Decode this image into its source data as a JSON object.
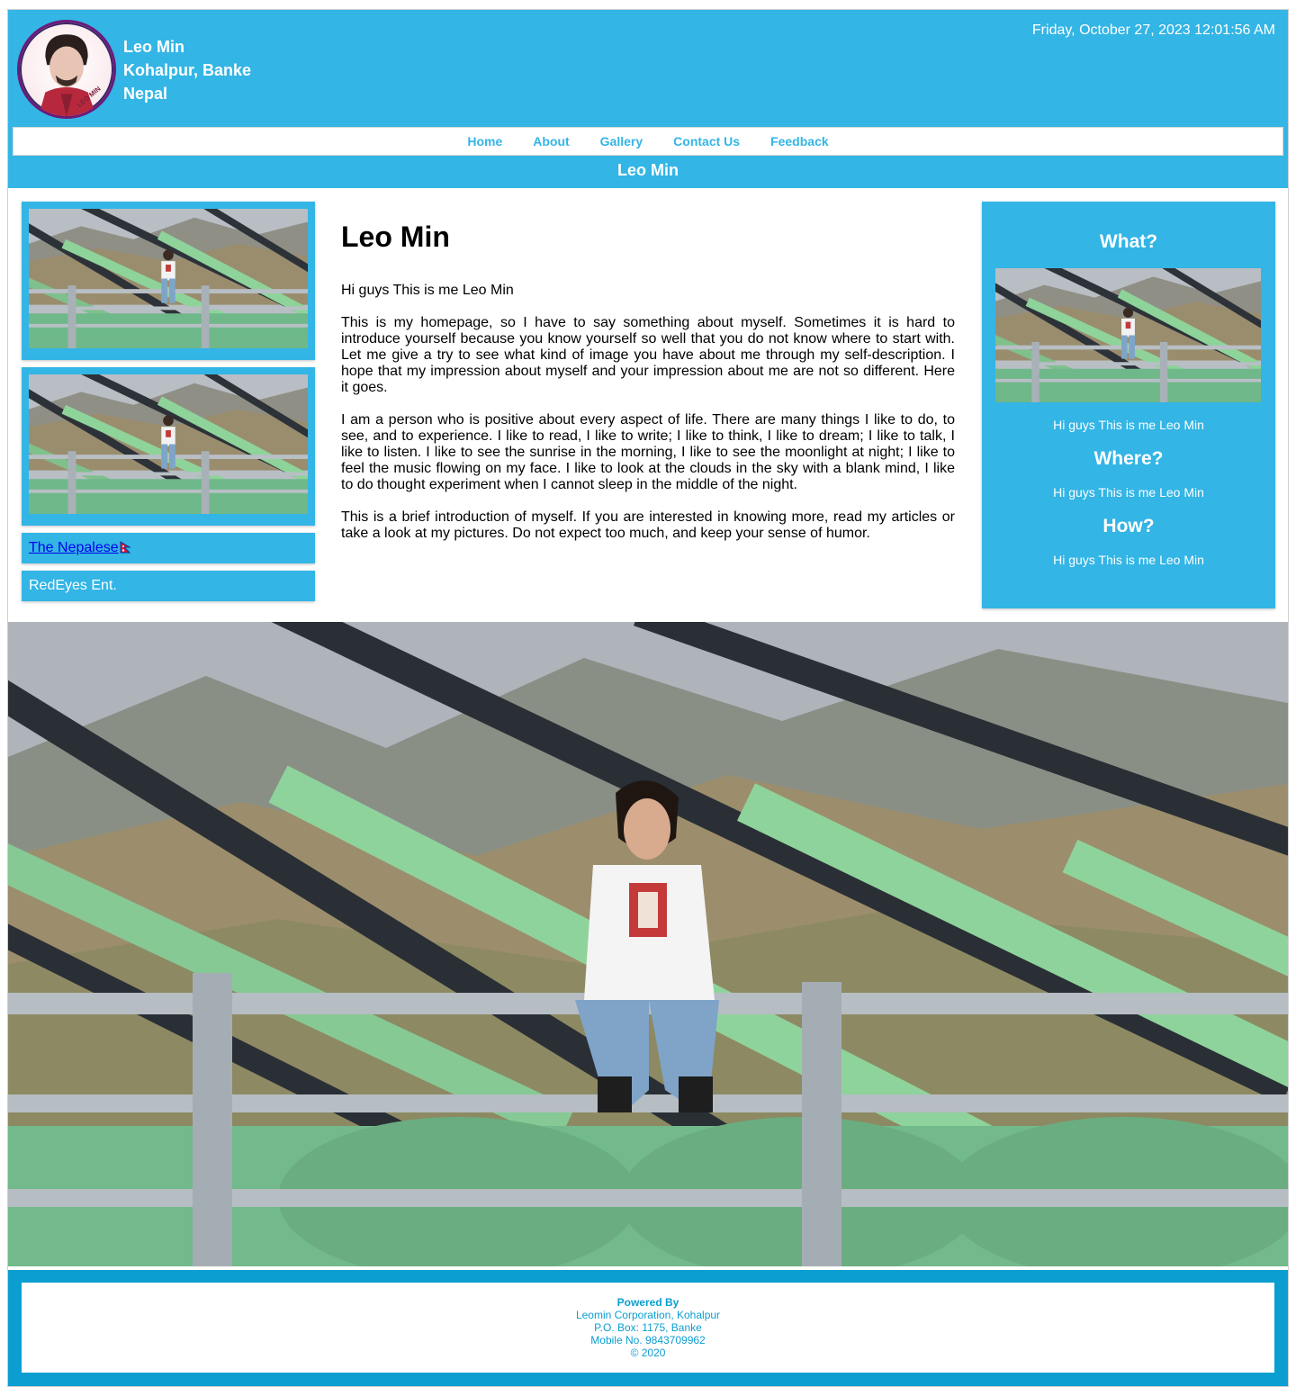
{
  "header": {
    "name": "Leo Min",
    "location": "Kohalpur, Banke",
    "country": "Nepal",
    "datetime": "Friday, October 27, 2023 12:01:56 AM",
    "avatar_text": "LEO MIN"
  },
  "nav": {
    "items": [
      "Home",
      "About",
      "Gallery",
      "Contact Us",
      "Feedback"
    ]
  },
  "banner": {
    "title": "Leo Min"
  },
  "sidebar_left": {
    "link_text": "The Nepalese",
    "plain_text": "RedEyes Ent."
  },
  "main": {
    "heading": "Leo Min",
    "paragraphs": [
      "Hi guys This is me Leo Min",
      "This is my homepage, so I have to say something about myself. Sometimes it is hard to introduce yourself because you know yourself so well that you do not know where to start with. Let me give a try to see what kind of image you have about me through my self-description. I hope that my impression about myself and your impression about me are not so different. Here it goes.",
      "I am a person who is positive about every aspect of life. There are many things I like to do, to see, and to experience. I like to read, I like to write; I like to think, I like to dream; I like to talk, I like to listen. I like to see the sunrise in the morning, I like to see the moonlight at night; I like to feel the music flowing on my face. I like to look at the clouds in the sky with a blank mind, I like to do thought experiment when I cannot sleep in the middle of the night.",
      "This is a brief introduction of myself. If you are interested in knowing more, read my articles or take a look at my pictures. Do not expect too much, and keep your sense of humor."
    ]
  },
  "sidebar_right": {
    "what_title": "What?",
    "what_text": "Hi guys This is me Leo Min",
    "where_title": "Where?",
    "where_text": "Hi guys This is me Leo Min",
    "how_title": "How?",
    "how_text": "Hi guys This is me Leo Min"
  },
  "footer": {
    "powered_by": "Powered By",
    "company": "Leomin Corporation, Kohalpur",
    "po_box": "P.O. Box: 1175, Banke",
    "mobile": "Mobile No. 9843709962",
    "copyright": "© 2020"
  },
  "colors": {
    "accent": "#33b5e5",
    "footer": "#0b9ed0",
    "link": "#0000ee"
  }
}
